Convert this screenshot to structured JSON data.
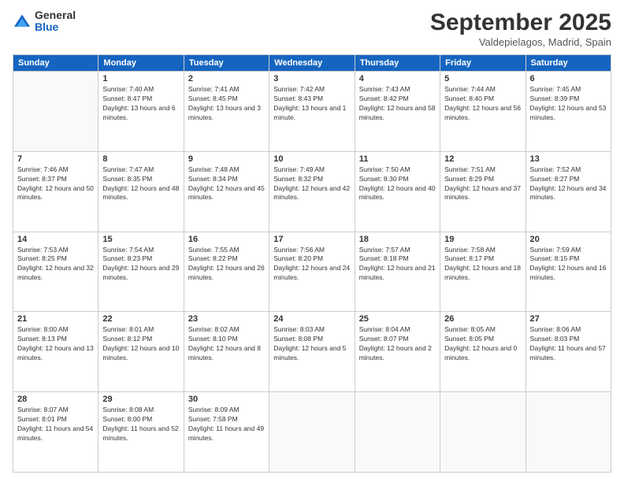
{
  "logo": {
    "general": "General",
    "blue": "Blue"
  },
  "header": {
    "month": "September 2025",
    "location": "Valdepielagos, Madrid, Spain"
  },
  "weekdays": [
    "Sunday",
    "Monday",
    "Tuesday",
    "Wednesday",
    "Thursday",
    "Friday",
    "Saturday"
  ],
  "weeks": [
    [
      {
        "day": "",
        "sunrise": "",
        "sunset": "",
        "daylight": ""
      },
      {
        "day": "1",
        "sunrise": "Sunrise: 7:40 AM",
        "sunset": "Sunset: 8:47 PM",
        "daylight": "Daylight: 13 hours and 6 minutes."
      },
      {
        "day": "2",
        "sunrise": "Sunrise: 7:41 AM",
        "sunset": "Sunset: 8:45 PM",
        "daylight": "Daylight: 13 hours and 3 minutes."
      },
      {
        "day": "3",
        "sunrise": "Sunrise: 7:42 AM",
        "sunset": "Sunset: 8:43 PM",
        "daylight": "Daylight: 13 hours and 1 minute."
      },
      {
        "day": "4",
        "sunrise": "Sunrise: 7:43 AM",
        "sunset": "Sunset: 8:42 PM",
        "daylight": "Daylight: 12 hours and 58 minutes."
      },
      {
        "day": "5",
        "sunrise": "Sunrise: 7:44 AM",
        "sunset": "Sunset: 8:40 PM",
        "daylight": "Daylight: 12 hours and 56 minutes."
      },
      {
        "day": "6",
        "sunrise": "Sunrise: 7:45 AM",
        "sunset": "Sunset: 8:39 PM",
        "daylight": "Daylight: 12 hours and 53 minutes."
      }
    ],
    [
      {
        "day": "7",
        "sunrise": "Sunrise: 7:46 AM",
        "sunset": "Sunset: 8:37 PM",
        "daylight": "Daylight: 12 hours and 50 minutes."
      },
      {
        "day": "8",
        "sunrise": "Sunrise: 7:47 AM",
        "sunset": "Sunset: 8:35 PM",
        "daylight": "Daylight: 12 hours and 48 minutes."
      },
      {
        "day": "9",
        "sunrise": "Sunrise: 7:48 AM",
        "sunset": "Sunset: 8:34 PM",
        "daylight": "Daylight: 12 hours and 45 minutes."
      },
      {
        "day": "10",
        "sunrise": "Sunrise: 7:49 AM",
        "sunset": "Sunset: 8:32 PM",
        "daylight": "Daylight: 12 hours and 42 minutes."
      },
      {
        "day": "11",
        "sunrise": "Sunrise: 7:50 AM",
        "sunset": "Sunset: 8:30 PM",
        "daylight": "Daylight: 12 hours and 40 minutes."
      },
      {
        "day": "12",
        "sunrise": "Sunrise: 7:51 AM",
        "sunset": "Sunset: 8:29 PM",
        "daylight": "Daylight: 12 hours and 37 minutes."
      },
      {
        "day": "13",
        "sunrise": "Sunrise: 7:52 AM",
        "sunset": "Sunset: 8:27 PM",
        "daylight": "Daylight: 12 hours and 34 minutes."
      }
    ],
    [
      {
        "day": "14",
        "sunrise": "Sunrise: 7:53 AM",
        "sunset": "Sunset: 8:25 PM",
        "daylight": "Daylight: 12 hours and 32 minutes."
      },
      {
        "day": "15",
        "sunrise": "Sunrise: 7:54 AM",
        "sunset": "Sunset: 8:23 PM",
        "daylight": "Daylight: 12 hours and 29 minutes."
      },
      {
        "day": "16",
        "sunrise": "Sunrise: 7:55 AM",
        "sunset": "Sunset: 8:22 PM",
        "daylight": "Daylight: 12 hours and 26 minutes."
      },
      {
        "day": "17",
        "sunrise": "Sunrise: 7:56 AM",
        "sunset": "Sunset: 8:20 PM",
        "daylight": "Daylight: 12 hours and 24 minutes."
      },
      {
        "day": "18",
        "sunrise": "Sunrise: 7:57 AM",
        "sunset": "Sunset: 8:18 PM",
        "daylight": "Daylight: 12 hours and 21 minutes."
      },
      {
        "day": "19",
        "sunrise": "Sunrise: 7:58 AM",
        "sunset": "Sunset: 8:17 PM",
        "daylight": "Daylight: 12 hours and 18 minutes."
      },
      {
        "day": "20",
        "sunrise": "Sunrise: 7:59 AM",
        "sunset": "Sunset: 8:15 PM",
        "daylight": "Daylight: 12 hours and 16 minutes."
      }
    ],
    [
      {
        "day": "21",
        "sunrise": "Sunrise: 8:00 AM",
        "sunset": "Sunset: 8:13 PM",
        "daylight": "Daylight: 12 hours and 13 minutes."
      },
      {
        "day": "22",
        "sunrise": "Sunrise: 8:01 AM",
        "sunset": "Sunset: 8:12 PM",
        "daylight": "Daylight: 12 hours and 10 minutes."
      },
      {
        "day": "23",
        "sunrise": "Sunrise: 8:02 AM",
        "sunset": "Sunset: 8:10 PM",
        "daylight": "Daylight: 12 hours and 8 minutes."
      },
      {
        "day": "24",
        "sunrise": "Sunrise: 8:03 AM",
        "sunset": "Sunset: 8:08 PM",
        "daylight": "Daylight: 12 hours and 5 minutes."
      },
      {
        "day": "25",
        "sunrise": "Sunrise: 8:04 AM",
        "sunset": "Sunset: 8:07 PM",
        "daylight": "Daylight: 12 hours and 2 minutes."
      },
      {
        "day": "26",
        "sunrise": "Sunrise: 8:05 AM",
        "sunset": "Sunset: 8:05 PM",
        "daylight": "Daylight: 12 hours and 0 minutes."
      },
      {
        "day": "27",
        "sunrise": "Sunrise: 8:06 AM",
        "sunset": "Sunset: 8:03 PM",
        "daylight": "Daylight: 11 hours and 57 minutes."
      }
    ],
    [
      {
        "day": "28",
        "sunrise": "Sunrise: 8:07 AM",
        "sunset": "Sunset: 8:01 PM",
        "daylight": "Daylight: 11 hours and 54 minutes."
      },
      {
        "day": "29",
        "sunrise": "Sunrise: 8:08 AM",
        "sunset": "Sunset: 8:00 PM",
        "daylight": "Daylight: 11 hours and 52 minutes."
      },
      {
        "day": "30",
        "sunrise": "Sunrise: 8:09 AM",
        "sunset": "Sunset: 7:58 PM",
        "daylight": "Daylight: 11 hours and 49 minutes."
      },
      {
        "day": "",
        "sunrise": "",
        "sunset": "",
        "daylight": ""
      },
      {
        "day": "",
        "sunrise": "",
        "sunset": "",
        "daylight": ""
      },
      {
        "day": "",
        "sunrise": "",
        "sunset": "",
        "daylight": ""
      },
      {
        "day": "",
        "sunrise": "",
        "sunset": "",
        "daylight": ""
      }
    ]
  ]
}
